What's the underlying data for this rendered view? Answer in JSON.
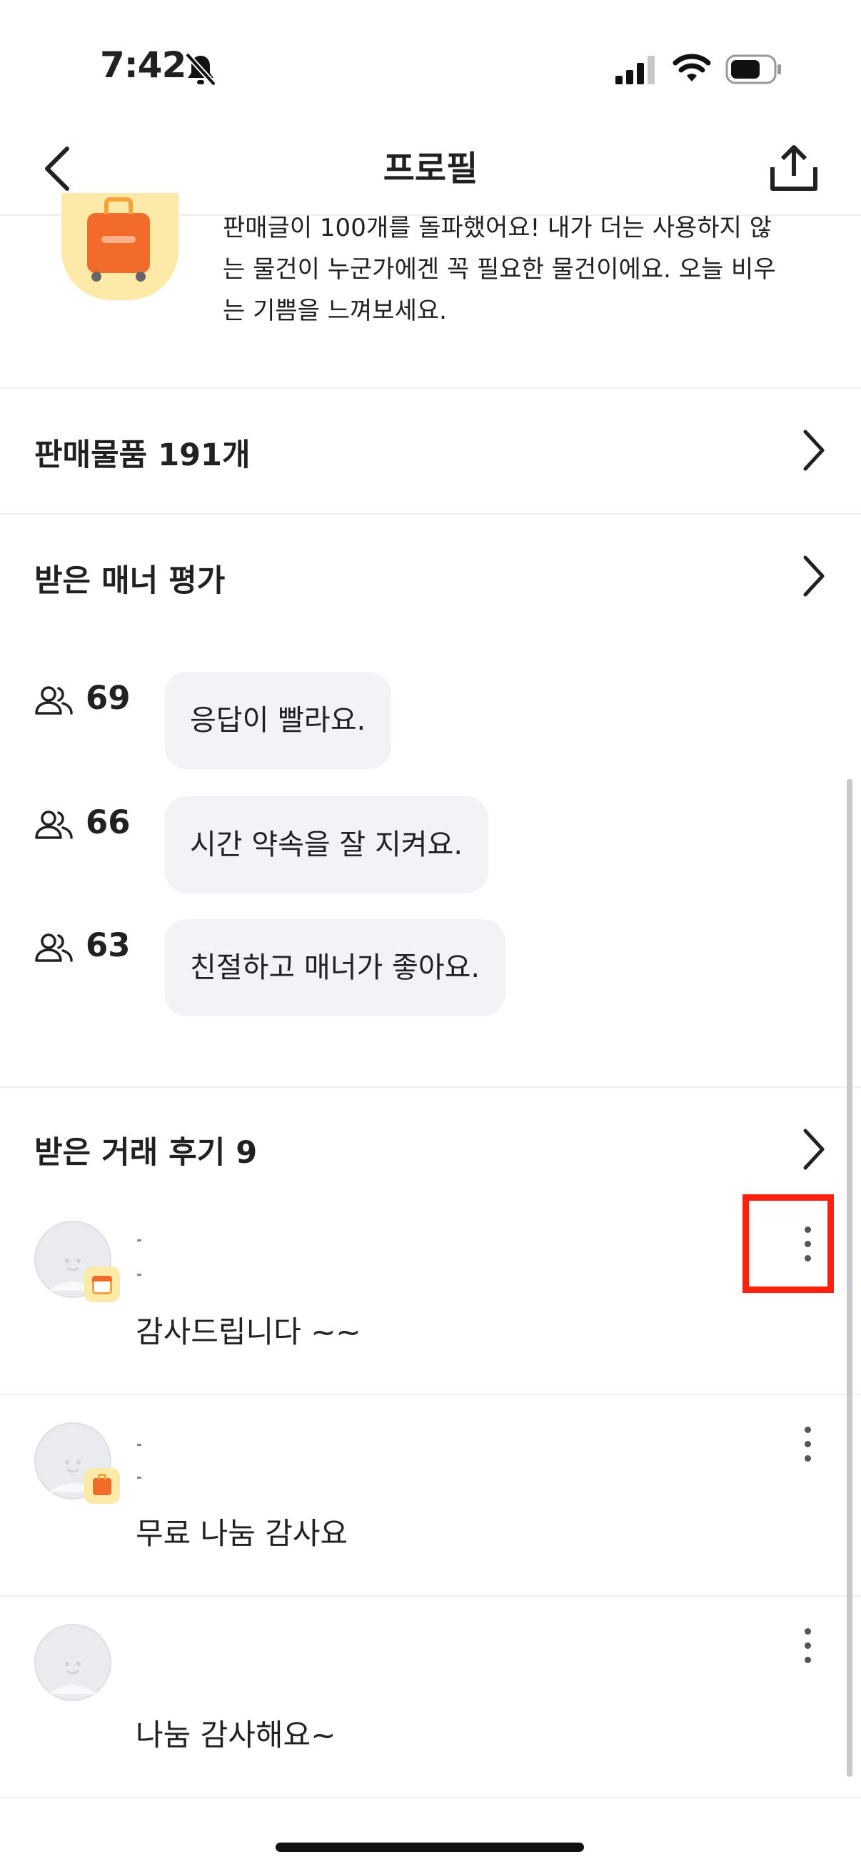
{
  "status_bar": {
    "time": "7:42",
    "icons": [
      "bell-slash-icon",
      "cellular-signal-icon",
      "wifi-icon",
      "battery-icon"
    ]
  },
  "nav": {
    "title": "프로필",
    "back_icon": "chevron-left-icon",
    "share_icon": "share-icon"
  },
  "badge": {
    "description": "판매글이 100개를 돌파했어요! 내가 더는 사용하지 않는 물건이 누군가에겐 꼭 필요한 물건이에요. 오늘 비우는 기쁨을 느껴보세요.",
    "icon": "suitcase-badge-icon"
  },
  "sections": {
    "items_for_sale": "판매물품 191개",
    "manner_reviews": "받은 매너 평가",
    "trade_reviews": "받은 거래 후기 9"
  },
  "manner_items": [
    {
      "count": "69",
      "text": "응답이 빨라요."
    },
    {
      "count": "66",
      "text": "시간 약속을 잘 지켜요."
    },
    {
      "count": "63",
      "text": "친절하고 매너가 좋아요."
    }
  ],
  "reviews": [
    {
      "text": "감사드립니다 ~~",
      "badge_icon": "calendar-badge-icon"
    },
    {
      "text": "무료 나눔 감사요",
      "badge_icon": "suitcase-badge-icon"
    },
    {
      "text": "나눔 감사해요~",
      "badge_icon": ""
    }
  ],
  "colors": {
    "highlight": "#ff1f0f",
    "bubble_bg": "#f2f3f6",
    "text": "#212124"
  }
}
